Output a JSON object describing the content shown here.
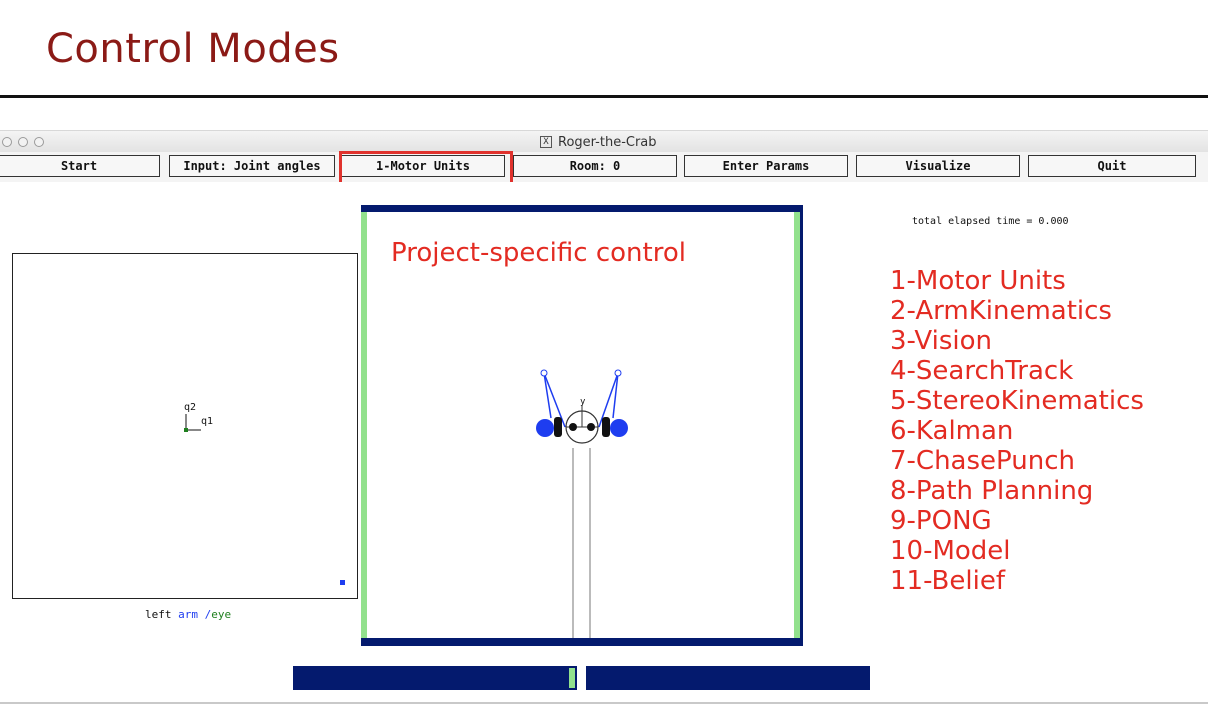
{
  "slide": {
    "title": "Control Modes"
  },
  "window": {
    "title": "Roger-the-Crab",
    "x11_icon": "X"
  },
  "toolbar": {
    "buttons": [
      "Start",
      "Input: Joint angles",
      "1-Motor Units",
      "Room: 0",
      "Enter Params",
      "Visualize",
      "Quit"
    ]
  },
  "left_panel": {
    "axis_label_q2": "q2",
    "axis_label_q1": "q1",
    "caption_left": "left",
    "caption_arm": "arm",
    "caption_sep": "/",
    "caption_eye": "eye"
  },
  "simulator": {
    "annotation": "Project-specific control",
    "eye_label": "y",
    "elapsed_time": "total elapsed time =  0.000"
  },
  "control_modes": [
    "1-Motor Units",
    "2-ArmKinematics",
    "3-Vision",
    "4-SearchTrack",
    "5-StereoKinematics",
    "6-Kalman",
    "7-ChasePunch",
    "8-Path Planning",
    "9-PONG",
    "10-Model",
    "11-Belief"
  ],
  "colors": {
    "slide_title": "#8b1a16",
    "annotation_red": "#e32b22",
    "room_navy": "#041a6e",
    "wall_green": "#92e18d",
    "arm_blue": "#1e3df0",
    "highlight": "#e0322d"
  }
}
